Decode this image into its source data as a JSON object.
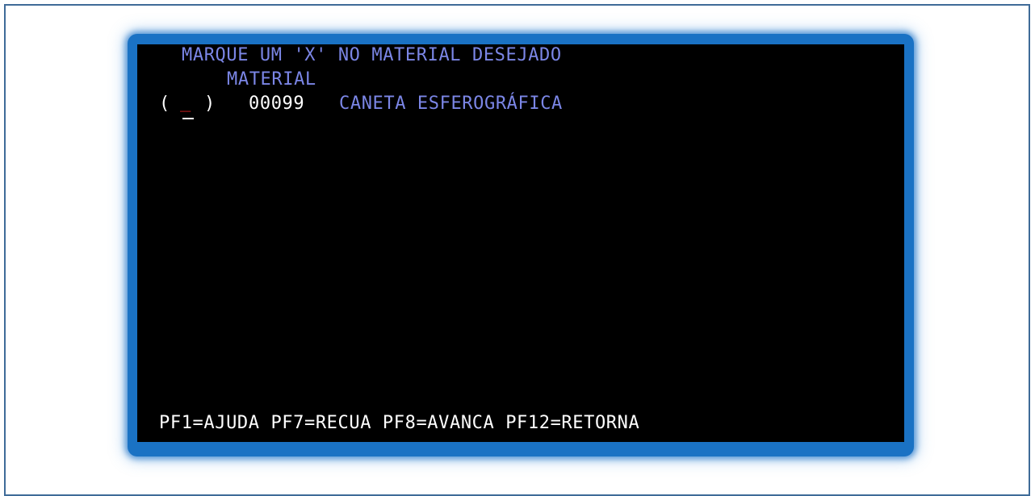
{
  "screen": {
    "header": "MARQUE UM 'X' NO MATERIAL DESEJADO",
    "column_header": "MATERIAL",
    "item": {
      "open_paren": "(",
      "selection_value": "_",
      "close_paren": ")",
      "code": "00099",
      "description": "CANETA ESFEROGRÁFICA"
    },
    "function_keys": "PF1=AJUDA PF7=RECUA PF8=AVANCA PF12=RETORNA"
  },
  "colors": {
    "terminal_background": "#000000",
    "label_text": "#7b86e6",
    "value_text": "#ffffff",
    "input_marker": "#e02020",
    "frame_glow": "#1a72c4",
    "page_border": "#3f6b98"
  }
}
